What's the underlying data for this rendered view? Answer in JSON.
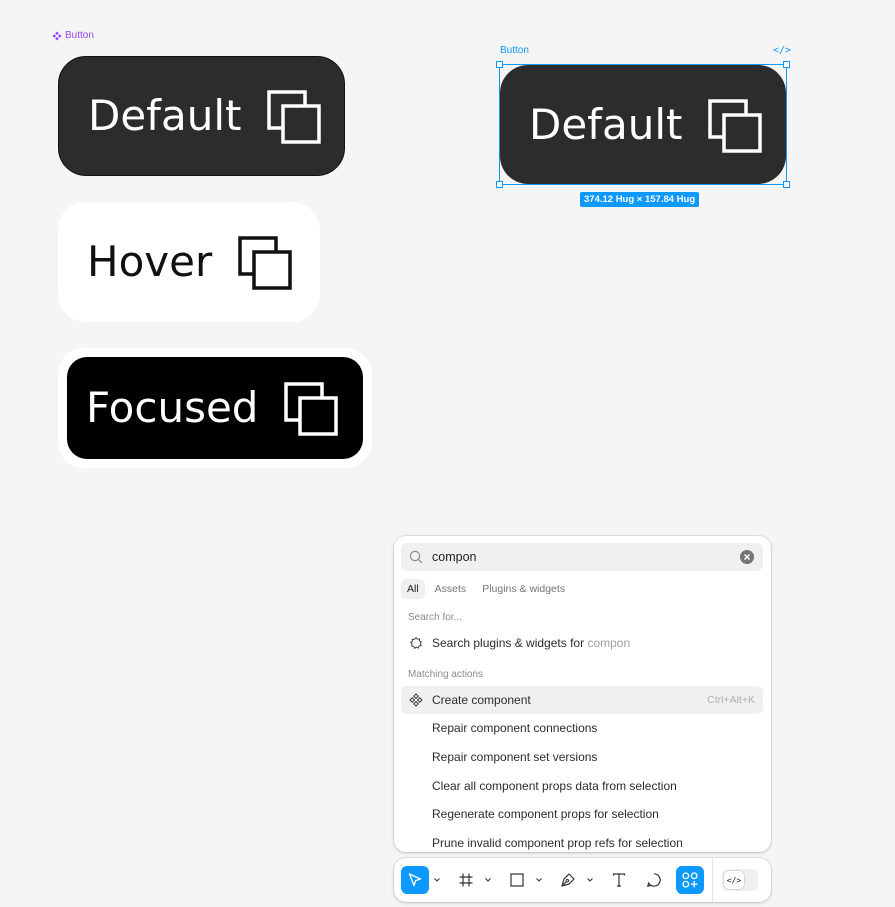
{
  "component_set": {
    "label": "Button",
    "accent": "#9747ff"
  },
  "variants": [
    {
      "label": "Default"
    },
    {
      "label": "Hover"
    },
    {
      "label": "Focused"
    }
  ],
  "selection": {
    "label": "Button",
    "code_icon": "</>",
    "button_label": "Default",
    "size_badge": "374.12 Hug × 157.84 Hug",
    "accent": "#0d99ff"
  },
  "icons": {
    "button": "copy-icon",
    "search": "search-icon",
    "clear": "clear-icon",
    "plugin": "plugin-icon",
    "component": "component-icon"
  },
  "quick_actions": {
    "search_value": "compon",
    "tabs": [
      "All",
      "Assets",
      "Plugins & widgets"
    ],
    "active_tab": "All",
    "search_for_heading": "Search for...",
    "search_plugins_text": "Search plugins & widgets for",
    "search_plugins_query": "compon",
    "matching_heading": "Matching actions",
    "actions": [
      {
        "label": "Create component",
        "shortcut": "Ctrl+Alt+K",
        "highlighted": true
      },
      {
        "label": "Repair component connections"
      },
      {
        "label": "Repair component set versions"
      },
      {
        "label": "Clear all component props data from selection"
      },
      {
        "label": "Regenerate component props for selection"
      },
      {
        "label": "Prune invalid component prop refs for selection"
      }
    ]
  },
  "toolbar": {
    "tools": [
      "move-tool",
      "frame-tool",
      "shape-tool",
      "pen-tool",
      "text-tool",
      "comment-tool",
      "actions-tool"
    ],
    "active_tool": "actions-tool",
    "dev_mode_icon": "</>"
  }
}
